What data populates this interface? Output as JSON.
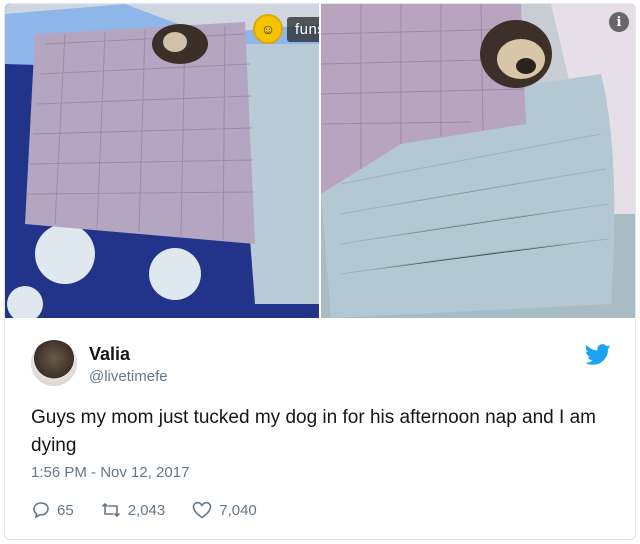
{
  "watermark": {
    "brand": "funssy.com",
    "icon": "smiley-face-icon"
  },
  "tweet": {
    "name": "Valia",
    "handle": "@livetimefe",
    "text": "Guys my mom just tucked my dog in for his afternoon nap and I am dying",
    "timestamp": "1:56 PM - Nov 12, 2017",
    "replies": "65",
    "retweets": "2,043",
    "likes": "7,040"
  },
  "colors": {
    "twitter_blue": "#1da1f2",
    "muted": "#657786"
  }
}
